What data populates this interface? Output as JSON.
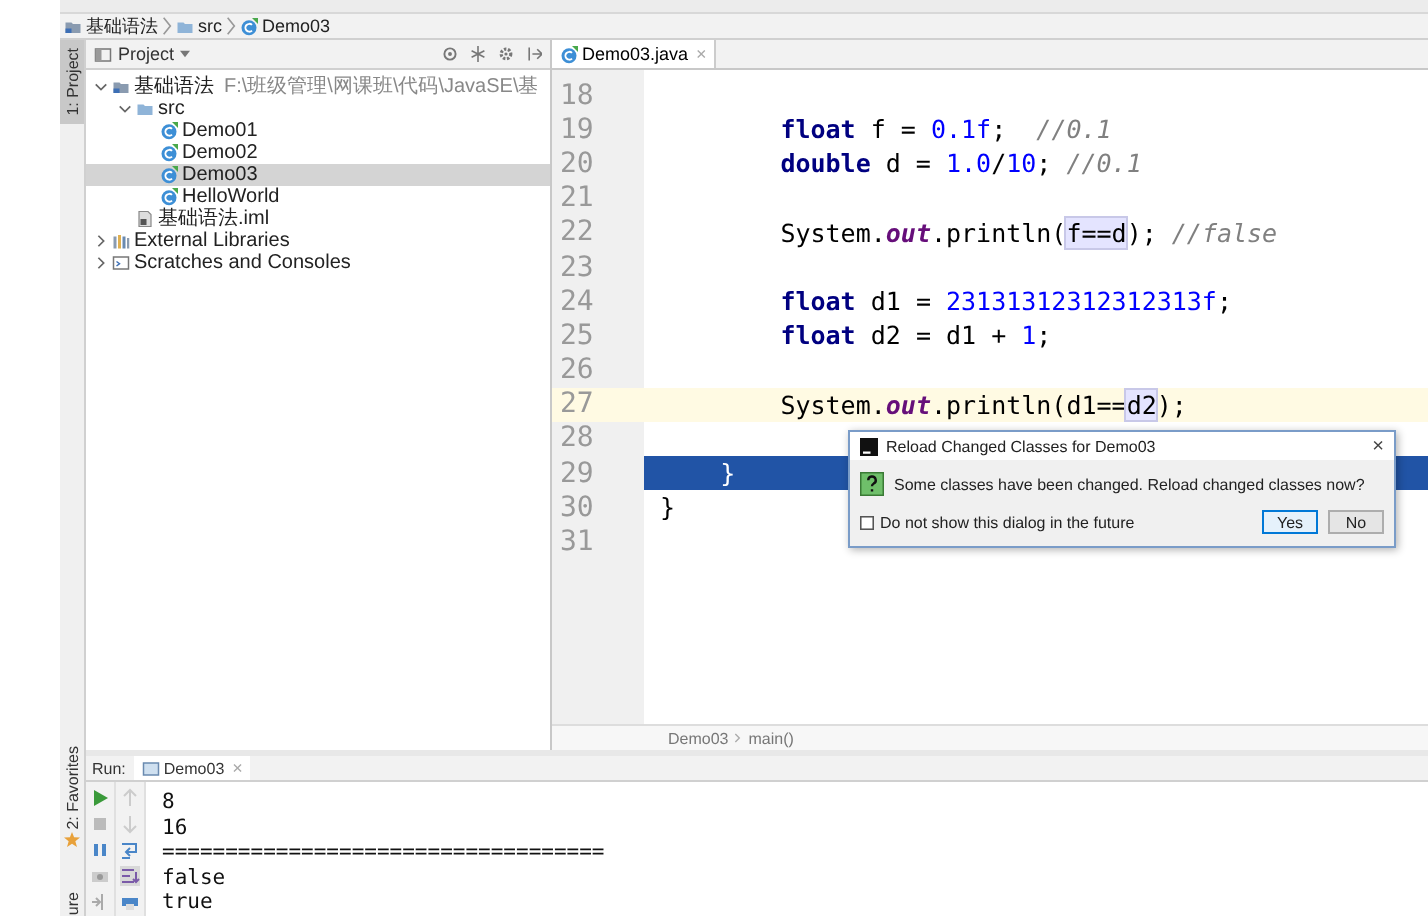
{
  "breadcrumbs": [
    {
      "label": "基础语法",
      "kind": "module"
    },
    {
      "label": "src",
      "kind": "folder"
    },
    {
      "label": "Demo03",
      "kind": "class"
    }
  ],
  "side_strip": [
    {
      "label": "1: Project",
      "kind": "project",
      "selected": true
    },
    {
      "label": "2: Favorites",
      "kind": "favorites",
      "selected": false
    },
    {
      "label": "ure",
      "kind": "structure",
      "selected": false
    }
  ],
  "project": {
    "title": "Project",
    "tree": [
      {
        "label": "基础语法",
        "path": "F:\\班级管理\\网课班\\代码\\JavaSE\\基",
        "kind": "module",
        "expanded": true,
        "selected": false,
        "children": [
          {
            "label": "src",
            "kind": "folder",
            "expanded": true,
            "selected": false,
            "children": [
              {
                "label": "Demo01",
                "kind": "class",
                "selected": false
              },
              {
                "label": "Demo02",
                "kind": "class",
                "selected": false
              },
              {
                "label": "Demo03",
                "kind": "class",
                "selected": true
              },
              {
                "label": "HelloWorld",
                "kind": "class",
                "selected": false
              }
            ]
          },
          {
            "label": "基础语法.iml",
            "kind": "file",
            "selected": false
          }
        ]
      },
      {
        "label": "External Libraries",
        "kind": "library",
        "expanded": false,
        "selected": false
      },
      {
        "label": "Scratches and Consoles",
        "kind": "scratch",
        "expanded": false,
        "selected": false
      }
    ]
  },
  "editor": {
    "tab": {
      "label": "Demo03.java",
      "close": "×"
    },
    "lines": [
      {
        "number": "18",
        "current": false,
        "selected": false
      },
      {
        "number": "19",
        "current": false,
        "selected": false,
        "tokens": [
          {
            "text": "        float",
            "kind": "keyword"
          },
          {
            "text": " f = ",
            "kind": "plain"
          },
          {
            "text": "0.1f",
            "kind": "number"
          },
          {
            "text": ";  ",
            "kind": "plain"
          },
          {
            "text": "//0.1",
            "kind": "comment"
          }
        ]
      },
      {
        "number": "20",
        "current": false,
        "selected": false,
        "tokens": [
          {
            "text": "        double",
            "kind": "keyword"
          },
          {
            "text": " d = ",
            "kind": "plain"
          },
          {
            "text": "1.0",
            "kind": "number"
          },
          {
            "text": "/",
            "kind": "plain"
          },
          {
            "text": "10",
            "kind": "number"
          },
          {
            "text": "; ",
            "kind": "plain"
          },
          {
            "text": "//0.1",
            "kind": "comment"
          }
        ]
      },
      {
        "number": "21",
        "current": false,
        "selected": false
      },
      {
        "number": "22",
        "current": false,
        "selected": false,
        "tokens": [
          {
            "text": "        System.",
            "kind": "plain"
          },
          {
            "text": "out",
            "kind": "field"
          },
          {
            "text": ".println(",
            "kind": "plain"
          },
          {
            "text": "f==d",
            "kind": "match"
          },
          {
            "text": "); ",
            "kind": "plain"
          },
          {
            "text": "//false",
            "kind": "comment"
          }
        ]
      },
      {
        "number": "23",
        "current": false,
        "selected": false
      },
      {
        "number": "24",
        "current": false,
        "selected": false,
        "tokens": [
          {
            "text": "        float",
            "kind": "keyword"
          },
          {
            "text": " d1 = ",
            "kind": "plain"
          },
          {
            "text": "23131312312312313f",
            "kind": "number"
          },
          {
            "text": ";",
            "kind": "plain"
          }
        ]
      },
      {
        "number": "25",
        "current": false,
        "selected": false,
        "tokens": [
          {
            "text": "        float",
            "kind": "keyword"
          },
          {
            "text": " d2 = d1 + ",
            "kind": "plain"
          },
          {
            "text": "1",
            "kind": "number"
          },
          {
            "text": ";",
            "kind": "plain"
          }
        ]
      },
      {
        "number": "26",
        "current": false,
        "selected": false
      },
      {
        "number": "27",
        "current": true,
        "selected": false,
        "tokens": [
          {
            "text": "        System.",
            "kind": "plain"
          },
          {
            "text": "out",
            "kind": "field"
          },
          {
            "text": ".println(d1==",
            "kind": "plain"
          },
          {
            "text": "d2",
            "kind": "match"
          },
          {
            "text": ");",
            "kind": "plain"
          }
        ]
      },
      {
        "number": "28",
        "current": false,
        "selected": false
      },
      {
        "number": "29",
        "current": false,
        "selected": true,
        "tokens": [
          {
            "text": "    }",
            "kind": "plain"
          }
        ]
      },
      {
        "number": "30",
        "current": false,
        "selected": false,
        "tokens": [
          {
            "text": "}",
            "kind": "plain"
          }
        ]
      },
      {
        "number": "31",
        "current": false,
        "selected": false
      }
    ],
    "breadcrumb": [
      "Demo03",
      "main()"
    ]
  },
  "dialog": {
    "title": "Reload Changed Classes for Demo03",
    "close": "×",
    "message": "Some classes have been changed. Reload changed classes now?",
    "checkbox": {
      "label": "Do not show this dialog in the future",
      "checked": false
    },
    "buttons": [
      {
        "label": "Yes",
        "selected": true
      },
      {
        "label": "No",
        "selected": false
      }
    ]
  },
  "run": {
    "label": "Run:",
    "tab": {
      "label": "Demo03",
      "close": "×"
    },
    "output": [
      "8",
      "16",
      "===================================",
      "false",
      "true"
    ]
  }
}
